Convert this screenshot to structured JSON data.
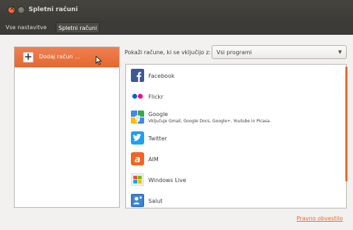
{
  "window": {
    "title": "Spletni računi"
  },
  "breadcrumb": {
    "all_settings": "Vse nastavitve",
    "current": "Spletni računi"
  },
  "sidebar": {
    "add_account_label": "Dodaj račun ..."
  },
  "filter": {
    "label": "Pokaži račune, ki se vključijo z:",
    "selected": "Vsi programi"
  },
  "providers": [
    {
      "name": "Facebook",
      "icon": "facebook-icon"
    },
    {
      "name": "Flickr",
      "icon": "flickr-icon"
    },
    {
      "name": "Google",
      "icon": "google-icon",
      "description": "Vključuje Gmail, Google Docs, Google+, Youtube in Picasa."
    },
    {
      "name": "Twitter",
      "icon": "twitter-icon"
    },
    {
      "name": "AIM",
      "icon": "aim-icon"
    },
    {
      "name": "Windows Live",
      "icon": "windows-live-icon"
    },
    {
      "name": "Salut",
      "icon": "salut-icon"
    }
  ],
  "footer": {
    "legal_link": "Pravno obvestilo"
  },
  "colors": {
    "accent": "#e3682f",
    "titlebar": "#3c3b37"
  }
}
